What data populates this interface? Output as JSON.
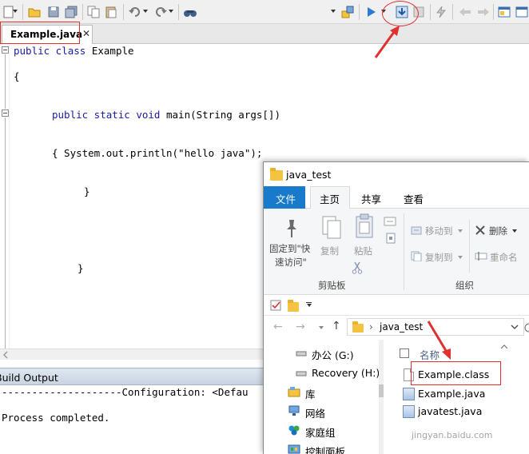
{
  "ide": {
    "toolbar": {
      "icons": [
        "new-file-icon",
        "open-icon",
        "save-icon",
        "save-all-icon",
        "copy-icon",
        "paste-icon",
        "undo-icon",
        "redo-icon",
        "find-icon",
        "target-icon",
        "run-icon",
        "compile-icon",
        "stop-icon",
        "plugin-icon",
        "back-icon",
        "forward-icon",
        "window-icon",
        "layout-icon"
      ]
    },
    "tab": {
      "label": "Example.java",
      "close": "✕"
    },
    "code": [
      {
        "kw": "public class",
        "rest": " Example"
      },
      {
        "kw": "",
        "rest": "{"
      },
      {
        "kw": "public static void",
        "rest": " main(String args[])"
      },
      {
        "pre": "{ System.out.println(",
        "str": "\"hello java\"",
        "post": ");"
      },
      {
        "kw": "",
        "rest": "}"
      },
      {
        "kw": "",
        "rest": "}"
      }
    ],
    "output": {
      "title": "Build Output",
      "lines": [
        "--------------------Configuration: <Defau",
        "Process completed."
      ]
    }
  },
  "explorer": {
    "title": "java_test",
    "tabs": {
      "file": "文件",
      "home": "主页",
      "share": "共享",
      "view": "查看"
    },
    "ribbon": {
      "pin_label_1": "固定到\"快",
      "pin_label_2": "速访问\"",
      "copy_label": "复制",
      "paste_label": "粘贴",
      "move_to": "移动到",
      "copy_to": "复制到",
      "delete": "删除",
      "rename": "重命名",
      "group_clipboard": "剪贴板",
      "group_organize": "组织"
    },
    "address": {
      "path": "java_test",
      "separator": "›"
    },
    "nav": [
      {
        "label": "办公 (G:)"
      },
      {
        "label": "Recovery (H:)"
      },
      {
        "label": "库"
      },
      {
        "label": "网络"
      },
      {
        "label": "家庭组"
      },
      {
        "label": "控制面板"
      }
    ],
    "column_header": "名称",
    "files": [
      {
        "name": "Example.class"
      },
      {
        "name": "Example.java"
      },
      {
        "name": "javatest.java"
      }
    ]
  },
  "watermark": "jingyan.baidu.com",
  "colors": {
    "annotation": "#e03030",
    "ribbon_blue": "#1979ca",
    "keyword": "#1a1aa6"
  }
}
